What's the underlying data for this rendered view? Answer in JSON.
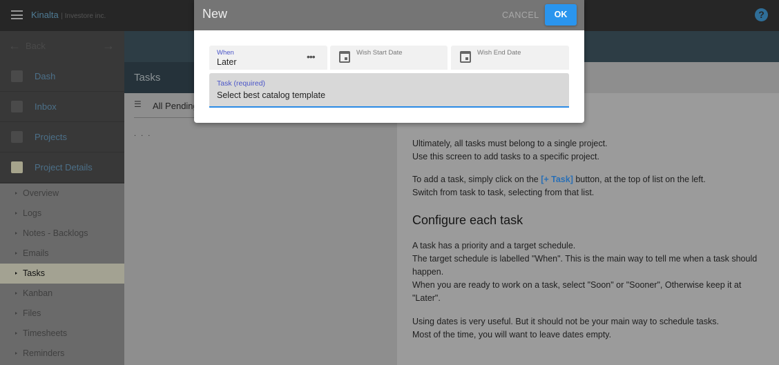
{
  "app": {
    "title": "Kinalta",
    "org": "Investore inc.",
    "help_icon": "help-circle-icon"
  },
  "nav": {
    "back": "Back",
    "items": [
      {
        "label": "Dash",
        "icon": "account-box-icon"
      },
      {
        "label": "Inbox",
        "icon": "inbox-icon"
      },
      {
        "label": "Projects",
        "icon": "list-icon"
      },
      {
        "label": "Project Details",
        "icon": "checklist-icon"
      }
    ],
    "sub_items": [
      "Overview",
      "Logs",
      "Notes - Backlogs",
      "Emails",
      "Tasks",
      "Kanban",
      "Files",
      "Timesheets",
      "Reminders"
    ],
    "selected_sub": "Tasks"
  },
  "tasks": {
    "title": "Tasks",
    "filter": "All Pending",
    "placeholder_dots": ". . ."
  },
  "help": {
    "p1": [
      "Ultimately, all tasks must belong to a single project.",
      "Use this screen to add tasks to a specific project."
    ],
    "p2a": "To add a task, simply click on the ",
    "p2link": "[+ Task]",
    "p2b": " button, at the top of list on the left.",
    "p2c": "Switch from task to task, selecting from that list.",
    "h2": "Configure each task",
    "p3": [
      "A task has a priority and a target schedule.",
      "The target schedule is labelled \"When\". This is the main way to tell me when a task should",
      "happen.",
      "When you are ready to work on a task, select \"Soon\" or \"Sooner\", Otherwise keep it at",
      "\"Later\"."
    ],
    "p4": [
      "Using dates is very useful. But it should not be your main way to schedule tasks.",
      "Most of the time, you will want to leave dates empty."
    ]
  },
  "dialog": {
    "title": "New",
    "cancel": "CANCEL",
    "ok": "OK",
    "when_label": "When",
    "when_value": "Later",
    "start_label": "Wish Start Date",
    "end_label": "Wish End Date",
    "task_label": "Task (required)",
    "task_value": "Select best catalog template"
  },
  "colors": {
    "accent": "#2a95ee",
    "link": "#2a6fb5"
  }
}
